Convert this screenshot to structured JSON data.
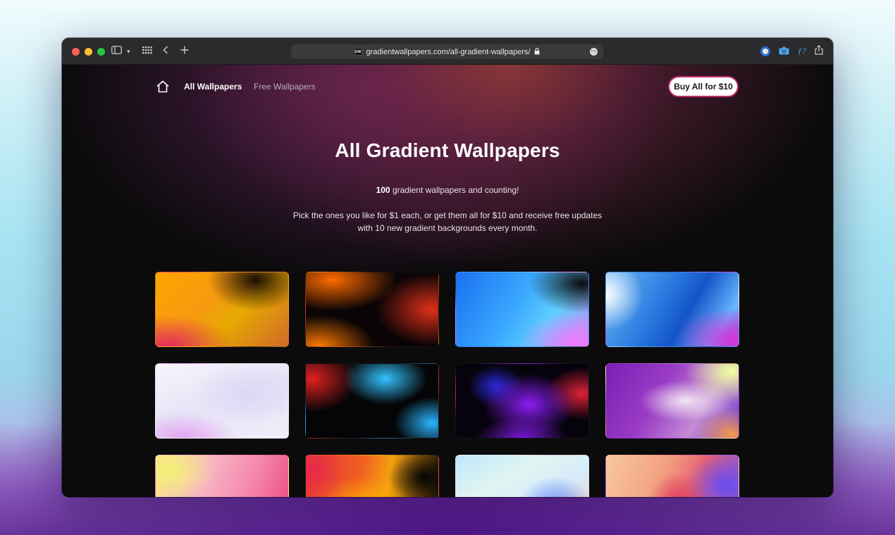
{
  "browser": {
    "url": "gradientwallpapers.com/all-gradient-wallpapers/",
    "favicon_text": "GW"
  },
  "nav": {
    "links": [
      {
        "label": "All Wallpapers"
      },
      {
        "label": "Free Wallpapers"
      }
    ],
    "buy_button": "Buy All for $10"
  },
  "hero": {
    "title": "All Gradient Wallpapers",
    "count": "100",
    "count_suffix": " gradient wallpapers and counting!",
    "description_line1": "Pick the ones you like for $1 each, or get them all for $10 and receive free updates",
    "description_line2": "with 10 new gradient backgrounds every month."
  },
  "icons": {
    "home": "home-icon",
    "sidebar": "sidebar-icon",
    "tab_grid": "tab-overview-icon",
    "back": "back-chevron-icon",
    "new_tab": "plus-icon",
    "lock": "lock-icon",
    "more": "more-icon",
    "grammarly": "grammarly-icon",
    "camera": "camera-icon",
    "font_finder": "font-finder-icon",
    "share": "share-icon"
  },
  "colors": {
    "accent_border": "#c22a6c",
    "page_bg": "#0b0b0c"
  }
}
